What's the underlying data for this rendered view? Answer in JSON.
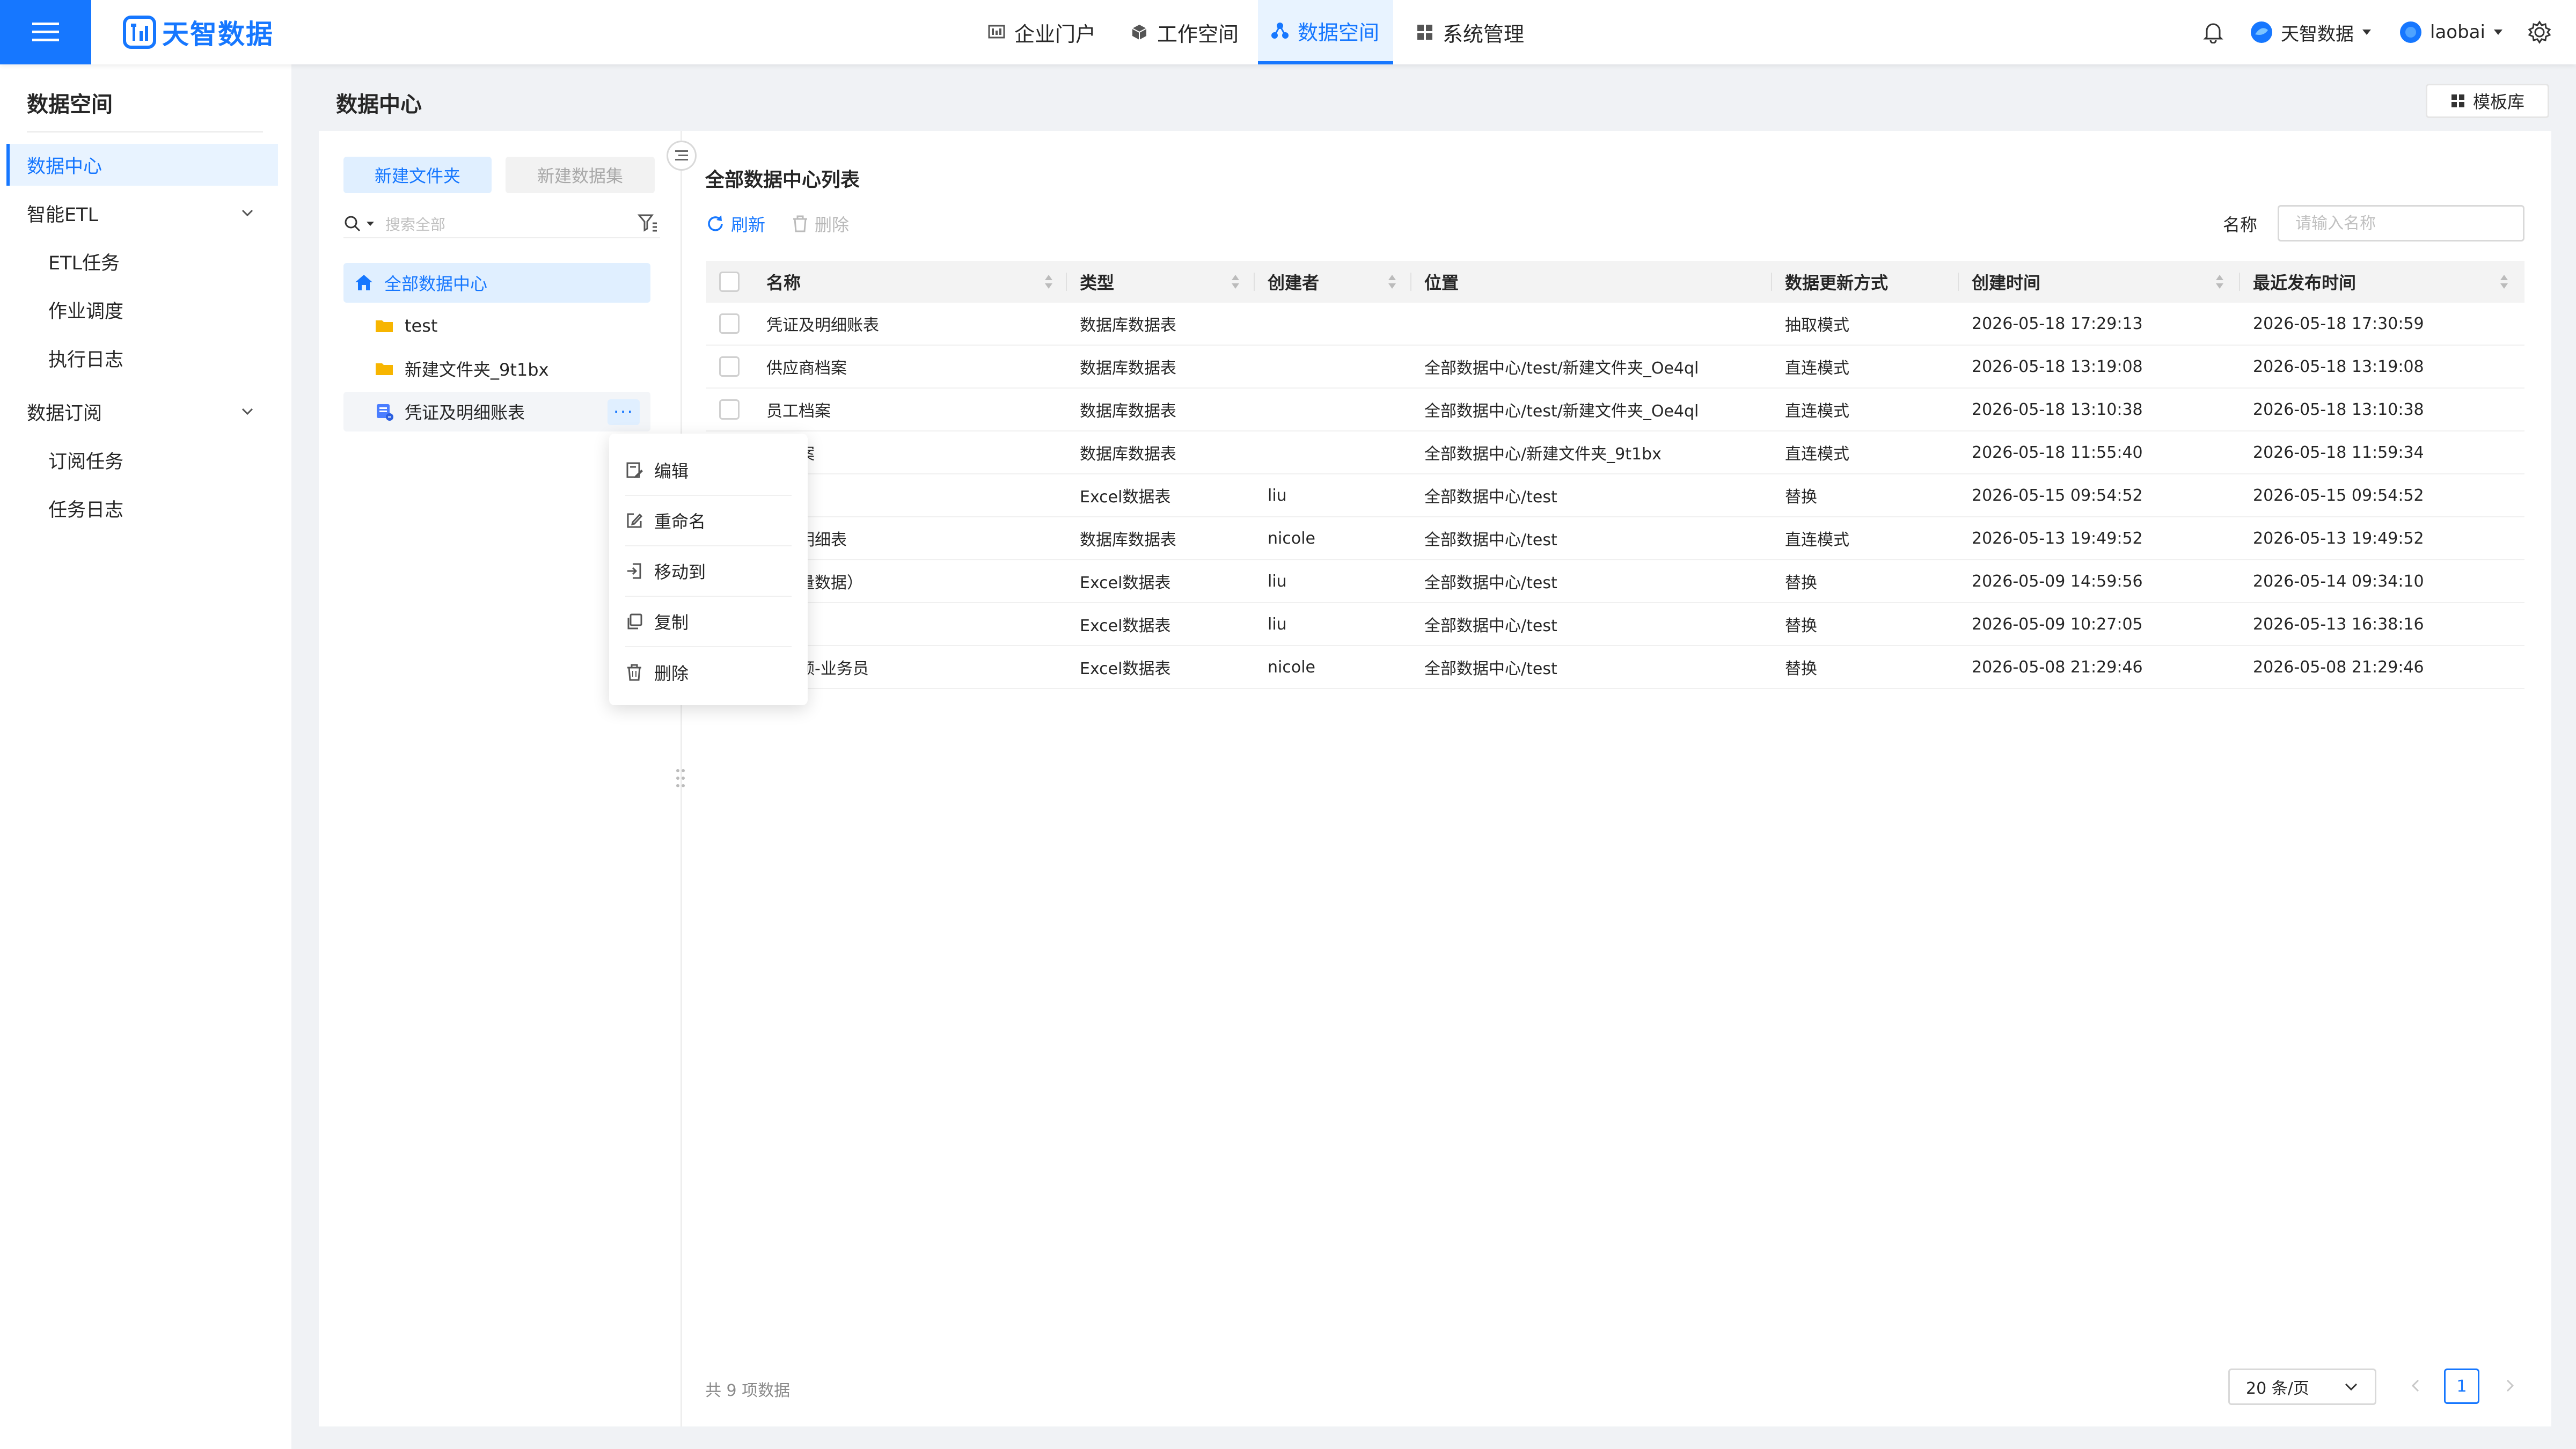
{
  "header": {
    "logo_text": "天智数据",
    "nav": [
      {
        "label": "企业门户",
        "icon": "portal-icon"
      },
      {
        "label": "工作空间",
        "icon": "cube-icon"
      },
      {
        "label": "数据空间",
        "icon": "data-space-icon",
        "active": true
      },
      {
        "label": "系统管理",
        "icon": "grid-icon"
      }
    ],
    "org_label": "天智数据",
    "user_label": "laobai"
  },
  "sidebar": {
    "title": "数据空间",
    "items": [
      {
        "label": "数据中心",
        "active": true
      },
      {
        "label": "智能ETL",
        "group": true
      },
      {
        "label": "ETL任务",
        "sub": true
      },
      {
        "label": "作业调度",
        "sub": true
      },
      {
        "label": "执行日志",
        "sub": true
      },
      {
        "label": "数据订阅",
        "group": true
      },
      {
        "label": "订阅任务",
        "sub": true
      },
      {
        "label": "任务日志",
        "sub": true
      }
    ]
  },
  "main": {
    "page_title": "数据中心",
    "template_button": "模板库",
    "tree": {
      "new_folder_label": "新建文件夹",
      "new_dataset_label": "新建数据集",
      "search_placeholder": "搜索全部",
      "nodes": [
        {
          "label": "全部数据中心",
          "icon": "home-icon",
          "selected": true
        },
        {
          "label": "test",
          "icon": "folder-icon"
        },
        {
          "label": "新建文件夹_9t1bx",
          "icon": "folder-icon"
        },
        {
          "label": "凭证及明细账表",
          "icon": "database-icon",
          "hovered": true
        }
      ],
      "more_label": "···"
    },
    "context_menu": [
      {
        "label": "编辑",
        "icon": "edit-icon"
      },
      {
        "label": "重命名",
        "icon": "rename-icon"
      },
      {
        "label": "移动到",
        "icon": "move-icon"
      },
      {
        "label": "复制",
        "icon": "copy-icon"
      },
      {
        "label": "删除",
        "icon": "trash-icon"
      }
    ],
    "list": {
      "title": "全部数据中心列表",
      "refresh_label": "刷新",
      "delete_label": "删除",
      "name_filter_label": "名称",
      "name_filter_placeholder": "请输入名称",
      "columns": [
        "名称",
        "类型",
        "创建者",
        "位置",
        "数据更新方式",
        "创建时间",
        "最近发布时间"
      ],
      "rows": [
        [
          "凭证及明细账表",
          "数据库数据表",
          "",
          "",
          "抽取模式",
          "2026-05-18 17:29:13",
          "2026-05-18 17:30:59"
        ],
        [
          "供应商档案",
          "数据库数据表",
          "",
          "全部数据中心/test/新建文件夹_Oe4ql",
          "直连模式",
          "2026-05-18 13:19:08",
          "2026-05-18 13:19:08"
        ],
        [
          "员工档案",
          "数据库数据表",
          "",
          "全部数据中心/test/新建文件夹_Oe4ql",
          "直连模式",
          "2026-05-18 13:10:38",
          "2026-05-18 13:10:38"
        ],
        [
          "商档案",
          "数据库数据表",
          "",
          "全部数据中心/新建文件夹_9t1bx",
          "直连模式",
          "2026-05-18 11:55:40",
          "2026-05-18 11:59:34"
        ],
        [
          "表",
          "Excel数据表",
          "liu",
          "全部数据中心/test",
          "替换",
          "2026-05-15 09:54:52",
          "2026-05-15 09:54:52"
        ],
        [
          "订单明细表",
          "数据库数据表",
          "nicole",
          "全部数据中心/test",
          "直连模式",
          "2026-05-13 19:49:52",
          "2026-05-13 19:49:52"
        ],
        [
          "（少量数据）",
          "Excel数据表",
          "liu",
          "全部数据中心/test",
          "替换",
          "2026-05-09 14:59:56",
          "2026-05-14 09:34:10"
        ],
        [
          "",
          "Excel数据表",
          "liu",
          "全部数据中心/test",
          "替换",
          "2026-05-09 10:27:05",
          "2026-05-13 16:38:16"
        ],
        [
          "目标额-业务员",
          "Excel数据表",
          "nicole",
          "全部数据中心/test",
          "替换",
          "2026-05-08 21:29:46",
          "2026-05-08 21:29:46"
        ]
      ]
    },
    "pagination": {
      "total_text": "共 9 项数据",
      "page_size_label": "20 条/页",
      "current_page": "1"
    }
  },
  "colors": {
    "accent": "#1677ff",
    "accent_light": "#e0efff",
    "folder": "#f7b500"
  }
}
